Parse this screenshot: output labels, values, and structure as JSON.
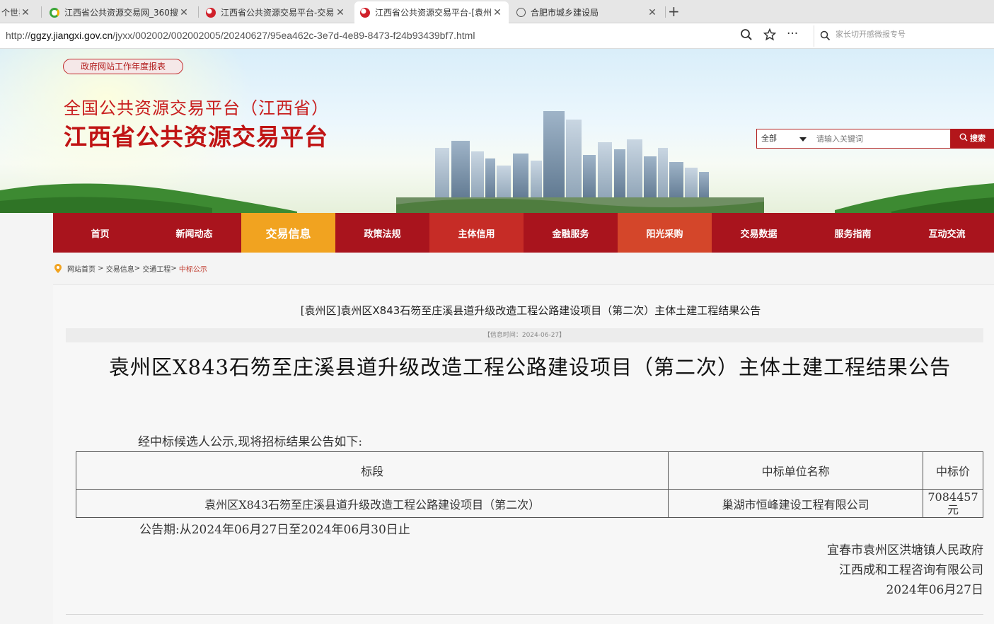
{
  "browser": {
    "tabs": [
      {
        "label": "个世界",
        "active": false
      },
      {
        "label": "江西省公共资源交易网_360搜",
        "active": false
      },
      {
        "label": "江西省公共资源交易平台-交易",
        "active": false
      },
      {
        "label": "江西省公共资源交易平台-[袁州",
        "active": true
      },
      {
        "label": "合肥市城乡建设局",
        "active": false
      }
    ],
    "url_prefix": "http://",
    "url_host": "ggzy.jiangxi.gov.cn",
    "url_path": "/jyxx/002002/002002005/20240627/95ea462c-3e7d-4e89-8473-f24b93439bf7.html",
    "search_placeholder": "家长切开感微报专号"
  },
  "header": {
    "report_link": "政府网站工作年度报表",
    "title_line1": "全国公共资源交易平台（江西省）",
    "title_line2": "江西省公共资源交易平台",
    "search": {
      "scope": "全部",
      "placeholder": "请输入关键词",
      "button": "搜索"
    }
  },
  "nav": {
    "items": [
      {
        "label": "首页"
      },
      {
        "label": "新闻动态"
      },
      {
        "label": "交易信息"
      },
      {
        "label": "政策法规"
      },
      {
        "label": "主体信用"
      },
      {
        "label": "金融服务"
      },
      {
        "label": "阳光采购"
      },
      {
        "label": "交易数据"
      },
      {
        "label": "服务指南"
      },
      {
        "label": "互动交流"
      }
    ]
  },
  "breadcrumb": {
    "items": [
      "网站首页",
      "交易信息",
      "交通工程"
    ],
    "current": "中标公示"
  },
  "article": {
    "bar_title": "[袁州区]袁州区X843石笏至庄溪县道升级改造工程公路建设项目（第二次）主体土建工程结果公告",
    "meta": "【信息时间：2024-06-27】",
    "title": "袁州区X843石笏至庄溪县道升级改造工程公路建设项目（第二次）主体土建工程结果公告",
    "intro": "经中标候选人公示,现将招标结果公告如下:",
    "table": {
      "headers": [
        "标段",
        "中标单位名称",
        "中标价"
      ],
      "rows": [
        [
          "袁州区X843石笏至庄溪县道升级改造工程公路建设项目（第二次）",
          "巢湖市恒峰建设工程有限公司",
          "7084457元"
        ]
      ]
    },
    "period": "公告期:从2024年06月27日至2024年06月30日止",
    "signatures": [
      "宜春市袁州区洪塘镇人民政府",
      "江西成和工程咨询有限公司",
      "2024年06月27日"
    ]
  },
  "colors": {
    "brand_red": "#a9141d",
    "nav_active": "#f1a320",
    "title_red": "#c81e1e"
  }
}
